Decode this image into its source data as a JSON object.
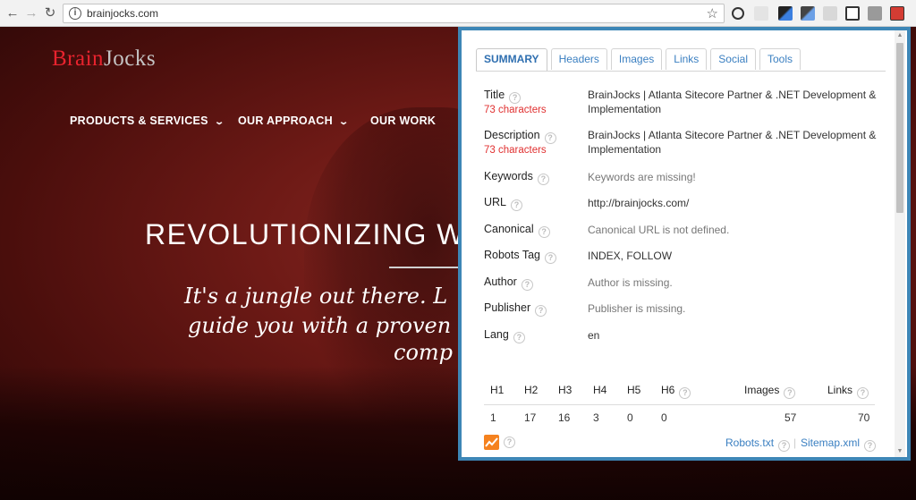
{
  "browser": {
    "url": "brainjocks.com",
    "back_glyph": "←",
    "forward_glyph": "→",
    "reload_glyph": "↻",
    "info_glyph": "i",
    "star_glyph": "☆"
  },
  "site": {
    "logo_brain": "Brain",
    "logo_jocks": "Jocks",
    "nav": [
      "PRODUCTS & SERVICES",
      "OUR APPROACH",
      "OUR WORK"
    ],
    "nav_chevron": "⌄",
    "headline": "REVOLUTIONIZING W",
    "tagline_lines": [
      "It's a jungle out there. L",
      "guide you with a proven",
      "comp"
    ]
  },
  "popup": {
    "tabs": [
      "SUMMARY",
      "Headers",
      "Images",
      "Links",
      "Social",
      "Tools"
    ],
    "help_glyph": "?",
    "rows": [
      {
        "label": "Title",
        "sub": "73 characters",
        "value": "BrainJocks | Atlanta Sitecore Partner & .NET Development & Implementation",
        "missing": false
      },
      {
        "label": "Description",
        "sub": "73 characters",
        "value": "BrainJocks | Atlanta Sitecore Partner & .NET Development & Implementation",
        "missing": false
      },
      {
        "label": "Keywords",
        "sub": "",
        "value": "Keywords are missing!",
        "missing": true
      },
      {
        "label": "URL",
        "sub": "",
        "value": "http://brainjocks.com/",
        "missing": false
      },
      {
        "label": "Canonical",
        "sub": "",
        "value": "Canonical URL is not defined.",
        "missing": true
      },
      {
        "label": "Robots Tag",
        "sub": "",
        "value": "INDEX, FOLLOW",
        "missing": false
      },
      {
        "label": "Author",
        "sub": "",
        "value": "Author is missing.",
        "missing": true
      },
      {
        "label": "Publisher",
        "sub": "",
        "value": "Publisher is missing.",
        "missing": true
      },
      {
        "label": "Lang",
        "sub": "",
        "value": "en",
        "missing": false
      }
    ],
    "stats": {
      "headers": [
        "H1",
        "H2",
        "H3",
        "H4",
        "H5",
        "H6",
        "Images",
        "Links"
      ],
      "values": [
        "1",
        "17",
        "16",
        "3",
        "0",
        "0",
        "57",
        "70"
      ]
    },
    "robots_link": "Robots.txt",
    "sitemap_link": "Sitemap.xml",
    "link_separator": "|"
  },
  "colors": {
    "accent_border": "#3d86b6",
    "warning_red": "#e03030",
    "link_blue": "#3a7fc1",
    "logo_red": "#e8232e"
  }
}
